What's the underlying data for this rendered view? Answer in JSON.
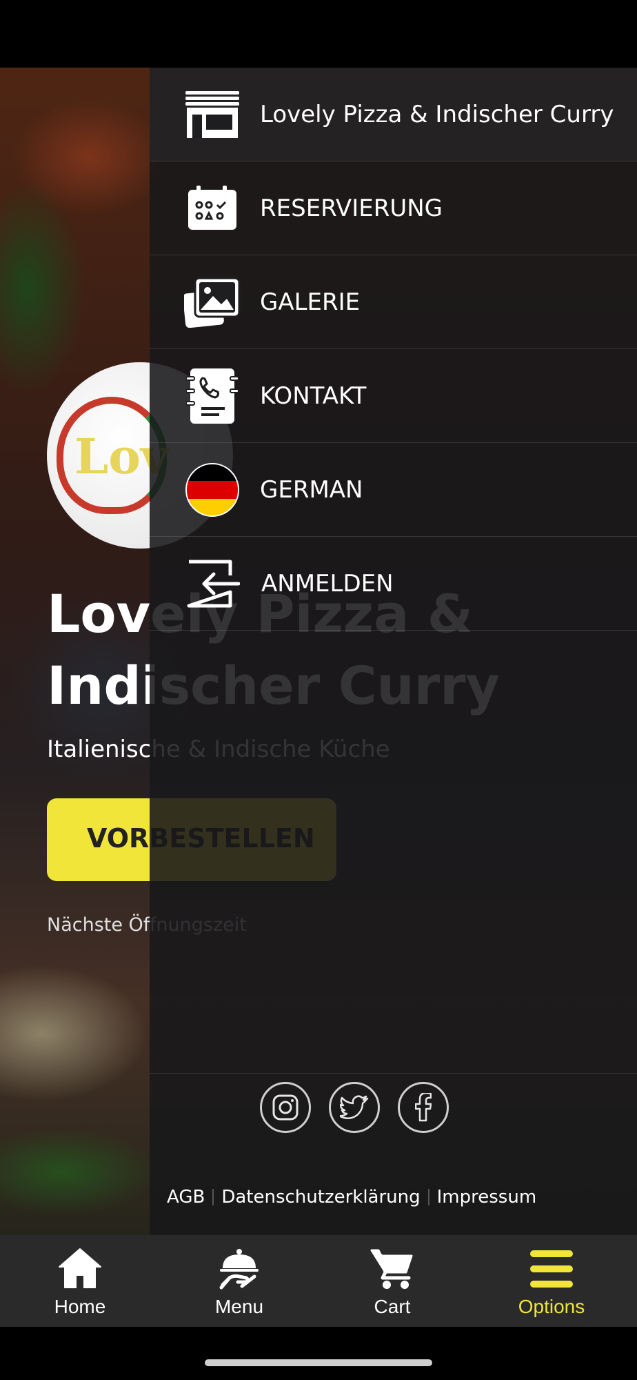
{
  "hero": {
    "logo_text": "Lov",
    "title_line1": "Lovely Pizza &",
    "title_line2": "Indischer Curry",
    "subtitle": "Italienische & Indische Küche",
    "cta": "VORBESTELLEN",
    "hours": "Nächste Öffnungszeit"
  },
  "drawer": {
    "items": [
      {
        "label": "Lovely Pizza & Indischer Curry",
        "icon": "store-icon"
      },
      {
        "label": "RESERVIERUNG",
        "icon": "calendar-icon"
      },
      {
        "label": "GALERIE",
        "icon": "gallery-icon"
      },
      {
        "label": "KONTAKT",
        "icon": "contact-book-icon"
      },
      {
        "label": "GERMAN",
        "icon": "german-flag-icon"
      },
      {
        "label": "ANMELDEN",
        "icon": "login-icon"
      }
    ],
    "social": [
      "instagram-icon",
      "twitter-icon",
      "facebook-icon"
    ],
    "footer_links": [
      "AGB",
      "Datenschutzerklärung",
      "Impressum"
    ]
  },
  "bottom_nav": {
    "tabs": [
      {
        "label": "Home",
        "icon": "home-icon"
      },
      {
        "label": "Menu",
        "icon": "cloche-icon"
      },
      {
        "label": "Cart",
        "icon": "cart-icon"
      },
      {
        "label": "Options",
        "icon": "hamburger-icon",
        "active": true
      }
    ]
  },
  "colors": {
    "accent": "#f2e53a",
    "drawer_bg": "#18181a",
    "nav_bg": "#2a2a2b",
    "flag_black": "#000000",
    "flag_red": "#dd0000",
    "flag_gold": "#ffce00"
  }
}
